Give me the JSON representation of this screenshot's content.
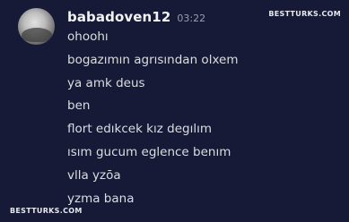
{
  "message_group": {
    "avatar_icon": "user-avatar-photo",
    "username": "babadoven12",
    "timestamp": "03:22",
    "messages": [
      "ohoohı",
      "bogazımın agrısından olxem",
      "ya amk deus",
      "ben",
      "flort edıkcek kız degılım",
      "ısım gucum eglence benım",
      "vlla yzōa",
      "yzma bana"
    ]
  },
  "watermarks": {
    "top_right": "BESTTURKS.COM",
    "bottom_left": "BESTTURKS.COM"
  },
  "colors": {
    "background": "#171a36",
    "username": "#f2f3f5",
    "message_text": "#dbdee1",
    "timestamp": "#9a9eb0"
  }
}
